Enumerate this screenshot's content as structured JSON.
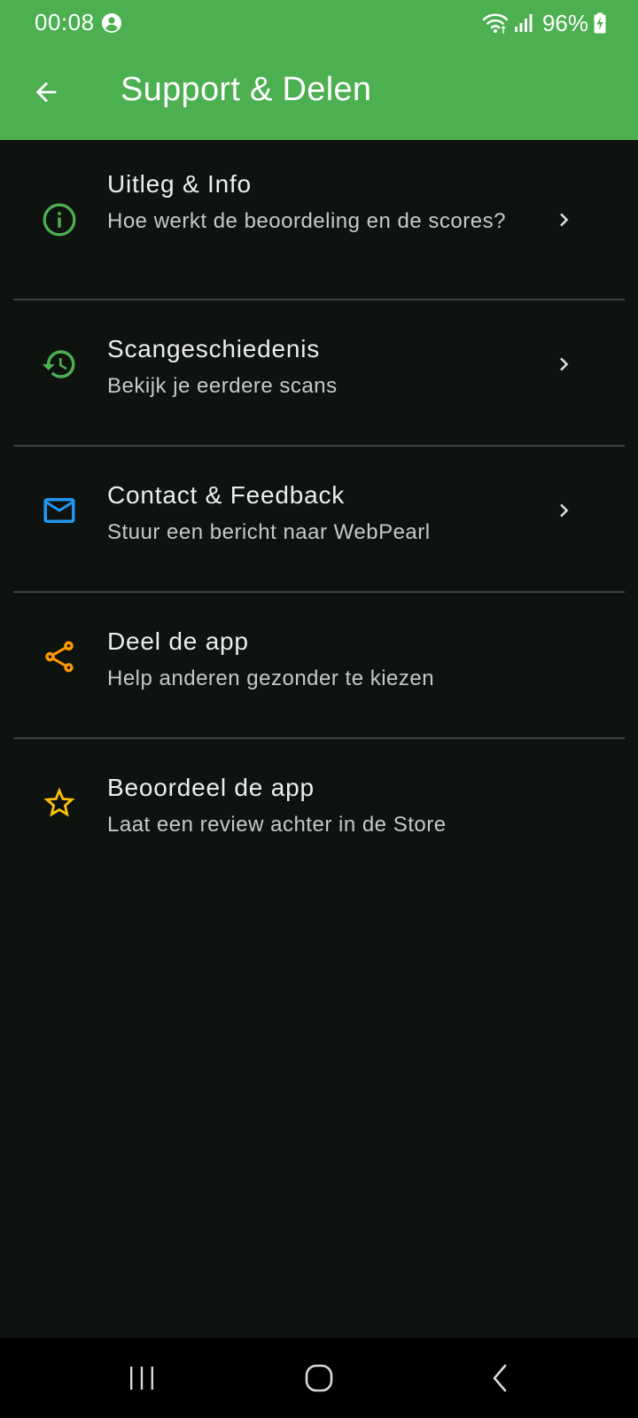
{
  "status_bar": {
    "time": "00:08",
    "battery": "96%"
  },
  "app_bar": {
    "title": "Support & Delen",
    "color": "#4caf50"
  },
  "items": [
    {
      "title": "Uitleg & Info",
      "subtitle": "Hoe werkt de beoordeling en de scores?",
      "icon": "info-icon",
      "icon_color": "#4caf50",
      "has_chevron": true
    },
    {
      "title": "Scangeschiedenis",
      "subtitle": "Bekijk je eerdere scans",
      "icon": "history-icon",
      "icon_color": "#4caf50",
      "has_chevron": true
    },
    {
      "title": "Contact & Feedback",
      "subtitle": "Stuur een bericht naar WebPearl",
      "icon": "mail-icon",
      "icon_color": "#2196f3",
      "has_chevron": true
    },
    {
      "title": "Deel de app",
      "subtitle": "Help anderen gezonder te kiezen",
      "icon": "share-icon",
      "icon_color": "#ff9800",
      "has_chevron": false
    },
    {
      "title": "Beoordeel de app",
      "subtitle": "Laat een review achter in de Store",
      "icon": "star-icon",
      "icon_color": "#ffc107",
      "has_chevron": false
    }
  ]
}
